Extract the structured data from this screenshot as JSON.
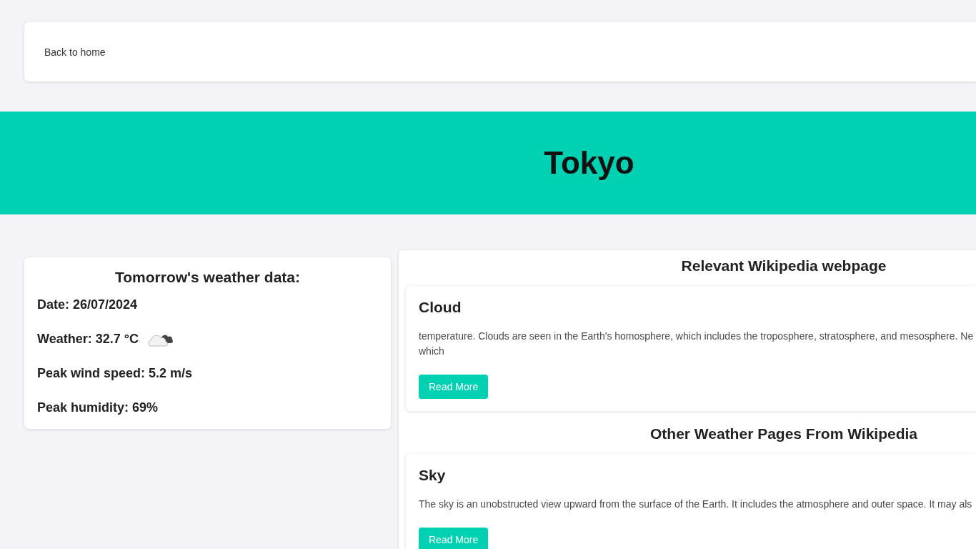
{
  "nav": {
    "link": "Back to home"
  },
  "hero": {
    "title": "Tokyo"
  },
  "weather": {
    "title": "Tomorrow's weather data:",
    "items": [
      {
        "kind": "text",
        "text": "Date: 26/07/2024"
      },
      {
        "kind": "icon",
        "text": "Weather: 32.7 °C"
      },
      {
        "kind": "text",
        "text": "Peak wind speed: 5.2 m/s"
      },
      {
        "kind": "text",
        "text": "Peak humidity: 69%"
      }
    ]
  },
  "relevant": {
    "title": "Relevant Wikipedia webpage",
    "articles": [
      {
        "title": "Cloud",
        "summary": [
          "temperature. Clouds are seen in the Earth's homosphere, which includes the troposphere, stratosphere, and mesosphere. Ne",
          "which"
        ],
        "button": "Read More"
      }
    ]
  },
  "other": {
    "title": "Other Weather Pages From Wikipedia",
    "articles": [
      {
        "title": "Sky",
        "summary": [
          "The sky is an unobstructed view upward from the surface of the Earth. It includes the atmosphere and outer space. It may als"
        ],
        "button": "Read More"
      }
    ]
  }
}
